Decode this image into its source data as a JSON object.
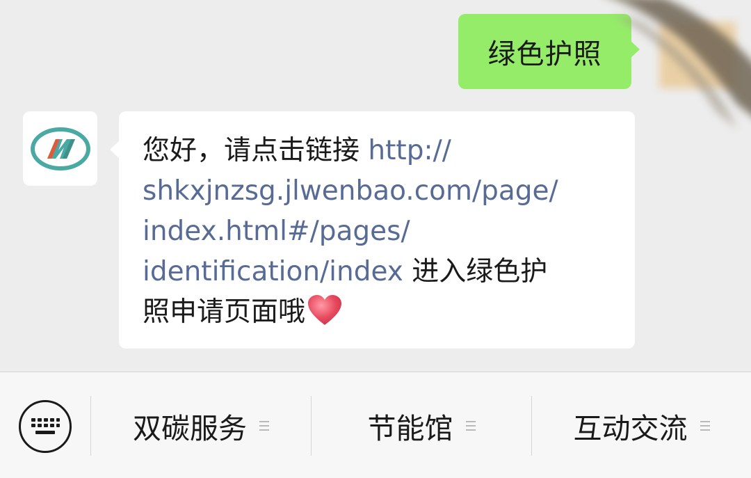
{
  "chat": {
    "outgoing_message": "绿色护照",
    "incoming_message": {
      "line1_text": "您好，请点击链接",
      "line1_link": "http://",
      "line2_link": "shkxjnzsg.jlwenbao.com/page/",
      "line3_link": "index.html#/pages/",
      "line4_link": "identification/index",
      "line4_text": "进入绿色护",
      "line5_text": "照申请页面哦",
      "emoji": "red-heart-icon"
    },
    "link_color": "#576b95",
    "outgoing_bubble_color": "#95ec69"
  },
  "menu": {
    "items": [
      {
        "label": "双碳服务",
        "icon": "hamburger-icon"
      },
      {
        "label": "节能馆",
        "icon": "hamburger-icon"
      },
      {
        "label": "互动交流",
        "icon": "hamburger-icon"
      }
    ],
    "keyboard_icon": "keyboard-icon"
  }
}
